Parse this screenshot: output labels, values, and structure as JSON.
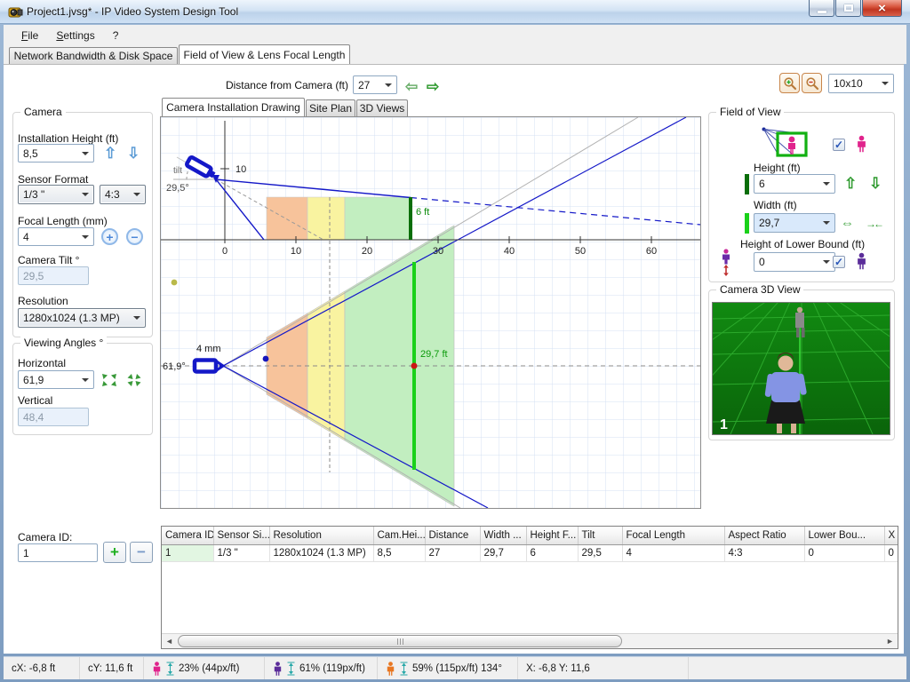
{
  "window": {
    "title": "Project1.jvsg* - IP Video System Design Tool",
    "menu": [
      "File",
      "Settings",
      "?"
    ],
    "main_tabs": [
      "Network Bandwidth & Disk Space",
      "Field of View & Lens Focal Length"
    ]
  },
  "toolbar": {
    "distance_label": "Distance from Camera  (ft)",
    "distance_value": "27",
    "grid_value": "10x10"
  },
  "camera_panel": {
    "group_title": "Camera",
    "installation_height_label": "Installation Height (ft)",
    "installation_height": "8,5",
    "sensor_format_label": "Sensor Format",
    "sensor_format": "1/3 \"",
    "aspect_ratio": "4:3",
    "focal_length_label": "Focal Length (mm)",
    "focal_length": "4",
    "camera_tilt_label": "Camera Tilt °",
    "camera_tilt": "29,5",
    "resolution_label": "Resolution",
    "resolution": "1280x1024 (1.3 MP)"
  },
  "viewing_angles_panel": {
    "group_title": "Viewing Angles °",
    "horizontal_label": "Horizontal",
    "horizontal": "61,9",
    "vertical_label": "Vertical",
    "vertical": "48,4"
  },
  "camera_id_panel": {
    "label": "Camera ID:",
    "value": "1"
  },
  "drawing": {
    "tabs": [
      "Camera Installation Drawing",
      "Site Plan",
      "3D Views"
    ],
    "axis_ticks": [
      "0",
      "10",
      "20",
      "30",
      "40",
      "50",
      "60"
    ],
    "side_view": {
      "height_tick": "10",
      "tilt_label": "tilt",
      "tilt_value": "29,5°",
      "target_height": "6 ft"
    },
    "top_view": {
      "focal": "4 mm",
      "hfov": "61,9°",
      "width_at_distance": "29,7 ft"
    }
  },
  "fov_panel": {
    "group_title": "Field of View",
    "height_label": "Height (ft)",
    "height": "6",
    "width_label": "Width (ft)",
    "width": "29,7",
    "lower_bound_label": "Height of Lower Bound (ft)",
    "lower_bound": "0"
  },
  "view3d_panel": {
    "group_title": "Camera 3D View",
    "camera_number": "1"
  },
  "table": {
    "columns": [
      "Camera ID",
      "Sensor Si...",
      "Resolution",
      "Cam.Hei...",
      "Distance",
      "Width ...",
      "Height F...",
      "Tilt",
      "Focal Length",
      "Aspect Ratio",
      "Lower Bou...",
      "X"
    ],
    "rows": [
      [
        "1",
        "1/3 \"",
        "1280x1024 (1.3 MP)",
        "8,5",
        "27",
        "29,7",
        "6",
        "29,5",
        "4",
        "4:3",
        "0",
        "0"
      ]
    ]
  },
  "status_bar": {
    "cx": "cX: -6,8 ft",
    "cy": "cY: 11,6 ft",
    "detection": "23% (44px/ft)",
    "recognition": "61% (119px/ft)",
    "identification": "59% (115px/ft) 134°",
    "xy": "X: -6,8 Y: 11,6"
  },
  "icons": {
    "app": "camera",
    "zoom_in": "magnifier-plus",
    "zoom_out": "magnifier-minus",
    "person_pink": "#e0248c",
    "person_purple": "#5b2d9a",
    "person_orange": "#e87722",
    "height_meter": "#28a8a8"
  },
  "colors": {
    "zone_near": "#f7c39b",
    "zone_mid": "#f9f3a0",
    "zone_far": "#c2eec0",
    "fov_line": "#1418c8",
    "target_bar_dark": "#0a6e0a",
    "target_bar_bright": "#1ad11a"
  }
}
